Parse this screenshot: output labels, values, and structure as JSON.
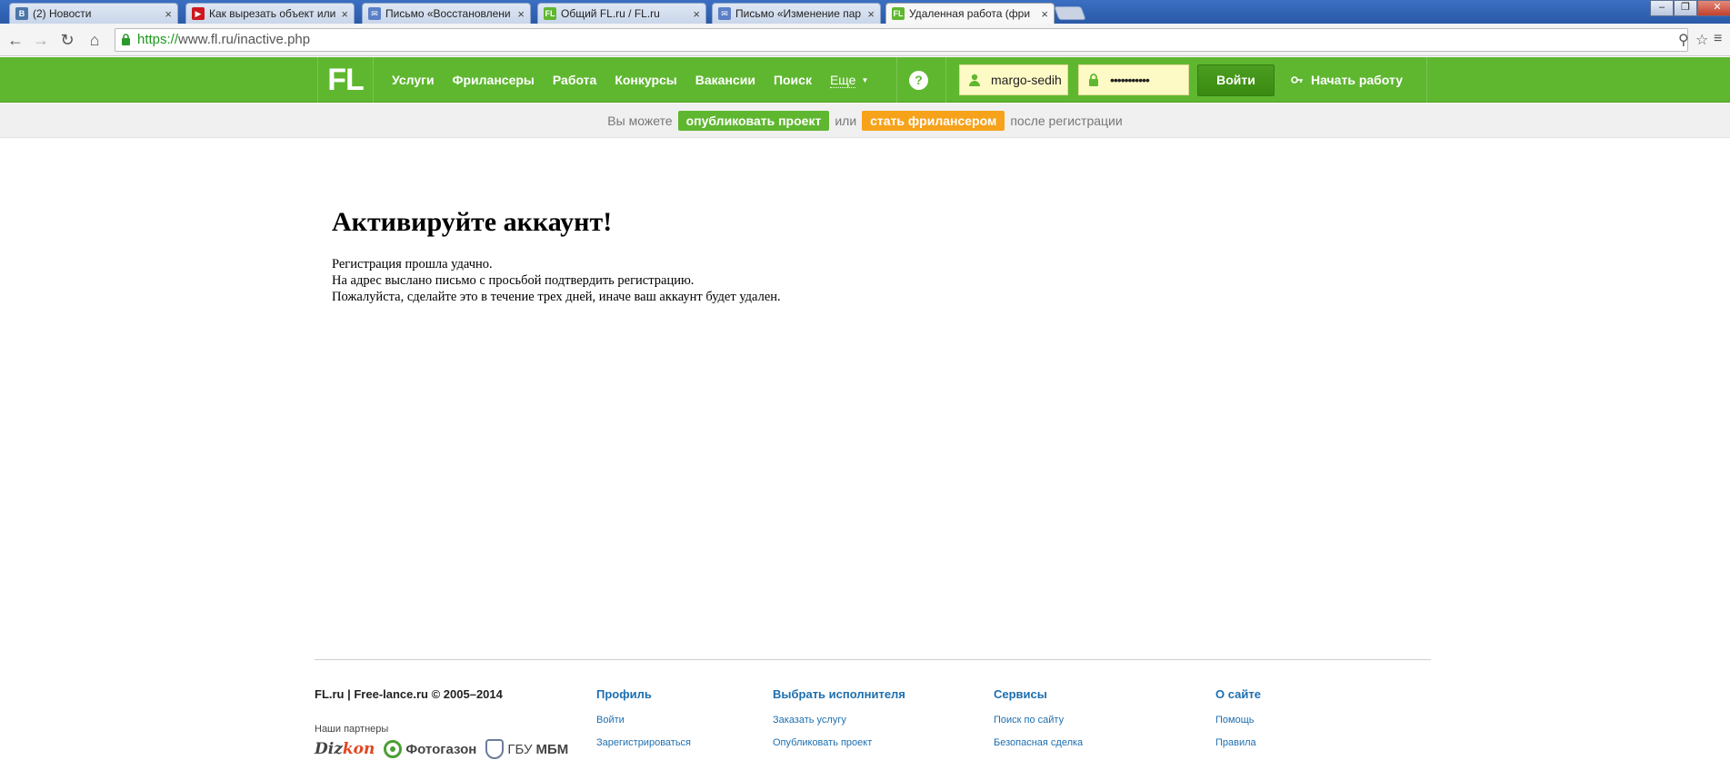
{
  "browser": {
    "tabs": [
      {
        "title": "(2) Новости",
        "favicon": "vk-icon",
        "fav_text": "В",
        "fav_color": "#4a76a8"
      },
      {
        "title": "Как вырезать объект или",
        "favicon": "youtube-icon",
        "fav_text": "▶",
        "fav_color": "#cc181e"
      },
      {
        "title": "Письмо «Восстановлени",
        "favicon": "mail-icon",
        "fav_text": "✉",
        "fav_color": "#5b7fc7"
      },
      {
        "title": "Общий FL.ru / FL.ru",
        "favicon": "fl-icon",
        "fav_text": "FL",
        "fav_color": "#5fb730"
      },
      {
        "title": "Письмо «Изменение пар",
        "favicon": "mail-icon",
        "fav_text": "✉",
        "fav_color": "#5b7fc7"
      },
      {
        "title": "Удаленная работа (фри",
        "favicon": "fl-icon",
        "fav_text": "FL",
        "fav_color": "#5fb730",
        "active": true
      }
    ],
    "tab_close": "×",
    "url_scheme": "https://",
    "url_rest": "www.fl.ru/inactive.php"
  },
  "header": {
    "logo": "FL",
    "nav": [
      "Услуги",
      "Фрилансеры",
      "Работа",
      "Конкурсы",
      "Вакансии",
      "Поиск"
    ],
    "more_label": "Еще",
    "help_label": "?",
    "login_value": "margo-sedih",
    "password_mask": "•••••••••••",
    "login_button": "Войти",
    "start_button": "Начать работу"
  },
  "strip": {
    "prefix": "Вы можете",
    "publish": "опубликовать проект",
    "or": "или",
    "become": "стать фрилансером",
    "suffix": "после регистрации"
  },
  "main": {
    "title": "Активируйте аккаунт!",
    "line1": "Регистрация прошла удачно.",
    "line2": "На адрес выслано письмо с просьбой подтвердить регистрацию.",
    "line3": "Пожалуйста, сделайте это в течение трех дней, иначе ваш аккаунт будет удален."
  },
  "footer": {
    "copyright": "FL.ru | Free-lance.ru © 2005–2014",
    "partners_label": "Наши партнеры",
    "partner_dizkon_a": "Diz",
    "partner_dizkon_b": "kon",
    "partner_foto": "Фотогазон",
    "partner_gbu_a": "ГБУ",
    "partner_gbu_b": "МБМ",
    "columns": [
      {
        "heading": "Профиль",
        "links": [
          "Войти",
          "Зарегистрироваться"
        ]
      },
      {
        "heading": "Выбрать исполнителя",
        "links": [
          "Заказать услугу",
          "Опубликовать проект"
        ]
      },
      {
        "heading": "Сервисы",
        "links": [
          "Поиск по сайту",
          "Безопасная сделка"
        ]
      },
      {
        "heading": "О сайте",
        "links": [
          "Помощь",
          "Правила"
        ]
      }
    ]
  }
}
